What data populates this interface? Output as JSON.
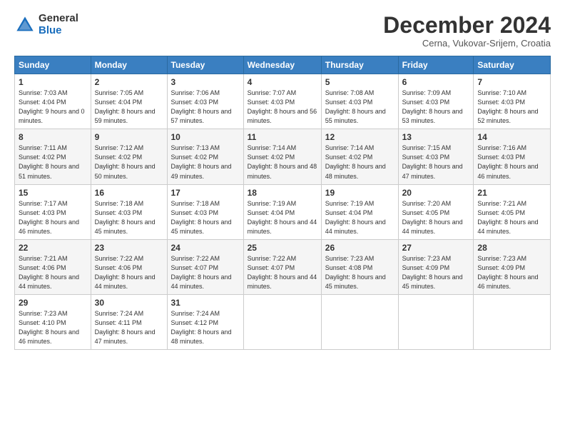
{
  "logo": {
    "general": "General",
    "blue": "Blue"
  },
  "title": "December 2024",
  "subtitle": "Cerna, Vukovar-Srijem, Croatia",
  "headers": [
    "Sunday",
    "Monday",
    "Tuesday",
    "Wednesday",
    "Thursday",
    "Friday",
    "Saturday"
  ],
  "weeks": [
    [
      {
        "day": "1",
        "sunrise": "Sunrise: 7:03 AM",
        "sunset": "Sunset: 4:04 PM",
        "daylight": "Daylight: 9 hours and 0 minutes."
      },
      {
        "day": "2",
        "sunrise": "Sunrise: 7:05 AM",
        "sunset": "Sunset: 4:04 PM",
        "daylight": "Daylight: 8 hours and 59 minutes."
      },
      {
        "day": "3",
        "sunrise": "Sunrise: 7:06 AM",
        "sunset": "Sunset: 4:03 PM",
        "daylight": "Daylight: 8 hours and 57 minutes."
      },
      {
        "day": "4",
        "sunrise": "Sunrise: 7:07 AM",
        "sunset": "Sunset: 4:03 PM",
        "daylight": "Daylight: 8 hours and 56 minutes."
      },
      {
        "day": "5",
        "sunrise": "Sunrise: 7:08 AM",
        "sunset": "Sunset: 4:03 PM",
        "daylight": "Daylight: 8 hours and 55 minutes."
      },
      {
        "day": "6",
        "sunrise": "Sunrise: 7:09 AM",
        "sunset": "Sunset: 4:03 PM",
        "daylight": "Daylight: 8 hours and 53 minutes."
      },
      {
        "day": "7",
        "sunrise": "Sunrise: 7:10 AM",
        "sunset": "Sunset: 4:03 PM",
        "daylight": "Daylight: 8 hours and 52 minutes."
      }
    ],
    [
      {
        "day": "8",
        "sunrise": "Sunrise: 7:11 AM",
        "sunset": "Sunset: 4:02 PM",
        "daylight": "Daylight: 8 hours and 51 minutes."
      },
      {
        "day": "9",
        "sunrise": "Sunrise: 7:12 AM",
        "sunset": "Sunset: 4:02 PM",
        "daylight": "Daylight: 8 hours and 50 minutes."
      },
      {
        "day": "10",
        "sunrise": "Sunrise: 7:13 AM",
        "sunset": "Sunset: 4:02 PM",
        "daylight": "Daylight: 8 hours and 49 minutes."
      },
      {
        "day": "11",
        "sunrise": "Sunrise: 7:14 AM",
        "sunset": "Sunset: 4:02 PM",
        "daylight": "Daylight: 8 hours and 48 minutes."
      },
      {
        "day": "12",
        "sunrise": "Sunrise: 7:14 AM",
        "sunset": "Sunset: 4:02 PM",
        "daylight": "Daylight: 8 hours and 48 minutes."
      },
      {
        "day": "13",
        "sunrise": "Sunrise: 7:15 AM",
        "sunset": "Sunset: 4:03 PM",
        "daylight": "Daylight: 8 hours and 47 minutes."
      },
      {
        "day": "14",
        "sunrise": "Sunrise: 7:16 AM",
        "sunset": "Sunset: 4:03 PM",
        "daylight": "Daylight: 8 hours and 46 minutes."
      }
    ],
    [
      {
        "day": "15",
        "sunrise": "Sunrise: 7:17 AM",
        "sunset": "Sunset: 4:03 PM",
        "daylight": "Daylight: 8 hours and 46 minutes."
      },
      {
        "day": "16",
        "sunrise": "Sunrise: 7:18 AM",
        "sunset": "Sunset: 4:03 PM",
        "daylight": "Daylight: 8 hours and 45 minutes."
      },
      {
        "day": "17",
        "sunrise": "Sunrise: 7:18 AM",
        "sunset": "Sunset: 4:03 PM",
        "daylight": "Daylight: 8 hours and 45 minutes."
      },
      {
        "day": "18",
        "sunrise": "Sunrise: 7:19 AM",
        "sunset": "Sunset: 4:04 PM",
        "daylight": "Daylight: 8 hours and 44 minutes."
      },
      {
        "day": "19",
        "sunrise": "Sunrise: 7:19 AM",
        "sunset": "Sunset: 4:04 PM",
        "daylight": "Daylight: 8 hours and 44 minutes."
      },
      {
        "day": "20",
        "sunrise": "Sunrise: 7:20 AM",
        "sunset": "Sunset: 4:05 PM",
        "daylight": "Daylight: 8 hours and 44 minutes."
      },
      {
        "day": "21",
        "sunrise": "Sunrise: 7:21 AM",
        "sunset": "Sunset: 4:05 PM",
        "daylight": "Daylight: 8 hours and 44 minutes."
      }
    ],
    [
      {
        "day": "22",
        "sunrise": "Sunrise: 7:21 AM",
        "sunset": "Sunset: 4:06 PM",
        "daylight": "Daylight: 8 hours and 44 minutes."
      },
      {
        "day": "23",
        "sunrise": "Sunrise: 7:22 AM",
        "sunset": "Sunset: 4:06 PM",
        "daylight": "Daylight: 8 hours and 44 minutes."
      },
      {
        "day": "24",
        "sunrise": "Sunrise: 7:22 AM",
        "sunset": "Sunset: 4:07 PM",
        "daylight": "Daylight: 8 hours and 44 minutes."
      },
      {
        "day": "25",
        "sunrise": "Sunrise: 7:22 AM",
        "sunset": "Sunset: 4:07 PM",
        "daylight": "Daylight: 8 hours and 44 minutes."
      },
      {
        "day": "26",
        "sunrise": "Sunrise: 7:23 AM",
        "sunset": "Sunset: 4:08 PM",
        "daylight": "Daylight: 8 hours and 45 minutes."
      },
      {
        "day": "27",
        "sunrise": "Sunrise: 7:23 AM",
        "sunset": "Sunset: 4:09 PM",
        "daylight": "Daylight: 8 hours and 45 minutes."
      },
      {
        "day": "28",
        "sunrise": "Sunrise: 7:23 AM",
        "sunset": "Sunset: 4:09 PM",
        "daylight": "Daylight: 8 hours and 46 minutes."
      }
    ],
    [
      {
        "day": "29",
        "sunrise": "Sunrise: 7:23 AM",
        "sunset": "Sunset: 4:10 PM",
        "daylight": "Daylight: 8 hours and 46 minutes."
      },
      {
        "day": "30",
        "sunrise": "Sunrise: 7:24 AM",
        "sunset": "Sunset: 4:11 PM",
        "daylight": "Daylight: 8 hours and 47 minutes."
      },
      {
        "day": "31",
        "sunrise": "Sunrise: 7:24 AM",
        "sunset": "Sunset: 4:12 PM",
        "daylight": "Daylight: 8 hours and 48 minutes."
      },
      null,
      null,
      null,
      null
    ]
  ]
}
